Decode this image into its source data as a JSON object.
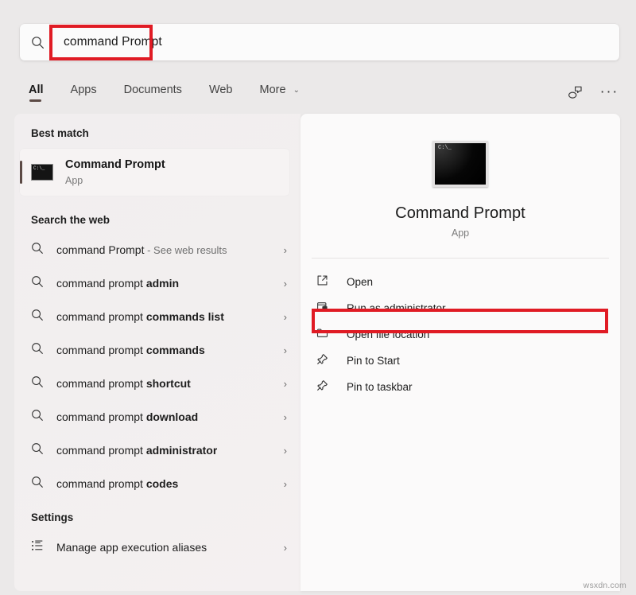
{
  "search": {
    "value": "command Prompt",
    "icon": "search-icon"
  },
  "tabs": {
    "items": [
      {
        "label": "All",
        "active": true
      },
      {
        "label": "Apps",
        "active": false
      },
      {
        "label": "Documents",
        "active": false
      },
      {
        "label": "Web",
        "active": false
      },
      {
        "label": "More",
        "active": false,
        "chevron": "⌄"
      }
    ],
    "actions": [
      {
        "name": "feedback-icon"
      },
      {
        "name": "more-options-icon",
        "label": "···"
      }
    ]
  },
  "left": {
    "best_match": {
      "heading": "Best match",
      "title": "Command Prompt",
      "subtitle": "App",
      "icon": "command-prompt-icon"
    },
    "web": {
      "heading": "Search the web",
      "items": [
        {
          "prefix": "command Prompt",
          "bold": "",
          "muted": " - See web results",
          "chevron": "›"
        },
        {
          "prefix": "command prompt ",
          "bold": "admin",
          "muted": "",
          "chevron": "›"
        },
        {
          "prefix": "command prompt ",
          "bold": "commands list",
          "muted": "",
          "chevron": "›"
        },
        {
          "prefix": "command prompt ",
          "bold": "commands",
          "muted": "",
          "chevron": "›"
        },
        {
          "prefix": "command prompt ",
          "bold": "shortcut",
          "muted": "",
          "chevron": "›"
        },
        {
          "prefix": "command prompt ",
          "bold": "download",
          "muted": "",
          "chevron": "›"
        },
        {
          "prefix": "command prompt ",
          "bold": "administrator",
          "muted": "",
          "chevron": "›"
        },
        {
          "prefix": "command prompt ",
          "bold": "codes",
          "muted": "",
          "chevron": "›"
        }
      ]
    },
    "settings": {
      "heading": "Settings",
      "items": [
        {
          "label": "Manage app execution aliases",
          "icon": "app-list-settings-icon",
          "chevron": "›"
        }
      ]
    }
  },
  "right": {
    "title": "Command Prompt",
    "subtitle": "App",
    "icon": "command-prompt-icon",
    "actions": [
      {
        "label": "Open",
        "icon": "open-external-icon"
      },
      {
        "label": "Run as administrator",
        "icon": "shield-window-icon"
      },
      {
        "label": "Open file location",
        "icon": "folder-icon"
      },
      {
        "label": "Pin to Start",
        "icon": "pin-icon"
      },
      {
        "label": "Pin to taskbar",
        "icon": "pin-icon"
      }
    ]
  },
  "annotations": {
    "color": "#e01b24",
    "boxes": [
      {
        "name": "search-input-highlight"
      },
      {
        "name": "run-as-administrator-highlight"
      }
    ]
  },
  "watermark": "wsxdn.com"
}
